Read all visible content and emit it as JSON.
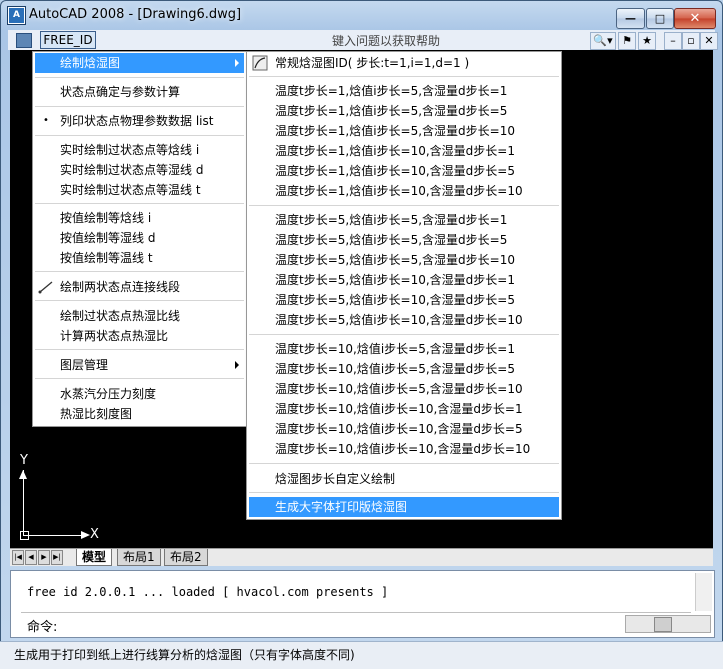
{
  "window": {
    "title": "AutoCAD 2008 - [Drawing6.dwg]",
    "app_icon": "A"
  },
  "caption_buttons": {
    "minimize": "—",
    "maximize": "□",
    "close": "✕"
  },
  "menubar": {
    "menu_label": "FREE_ID",
    "help_placeholder": "键入问题以获取帮助",
    "tools": [
      "🔍▾",
      "⚑",
      "★",
      "–",
      "▫",
      "✕"
    ]
  },
  "main_menu": {
    "items": [
      {
        "label": "绘制焓湿图",
        "submenu": true,
        "highlighted": true
      },
      {
        "label": "状态点确定与参数计算"
      },
      {
        "label": "列印状态点物理参数数据 list",
        "bullet": true
      },
      {
        "label": "实时绘制过状态点等焓线 i"
      },
      {
        "label": "实时绘制过状态点等湿线 d"
      },
      {
        "label": "实时绘制过状态点等温线 t"
      },
      {
        "label": "按值绘制等焓线 i"
      },
      {
        "label": "按值绘制等湿线 d"
      },
      {
        "label": "按值绘制等温线 t"
      },
      {
        "label": "绘制两状态点连接线段",
        "icon": "line-icon"
      },
      {
        "label": "绘制过状态点热湿比线"
      },
      {
        "label": "计算两状态点热湿比"
      },
      {
        "label": "图层管理",
        "submenu": true
      },
      {
        "label": "水蒸汽分压力刻度"
      },
      {
        "label": "热湿比刻度图"
      }
    ]
  },
  "sub_menu": {
    "header": "常规焓湿图ID( 步长:t=1,i=1,d=1 )",
    "group1": [
      "温度t步长=1,焓值i步长=5,含湿量d步长=1",
      "温度t步长=1,焓值i步长=5,含湿量d步长=5",
      "温度t步长=1,焓值i步长=5,含湿量d步长=10",
      "温度t步长=1,焓值i步长=10,含湿量d步长=1",
      "温度t步长=1,焓值i步长=10,含湿量d步长=5",
      "温度t步长=1,焓值i步长=10,含湿量d步长=10"
    ],
    "group2": [
      "温度t步长=5,焓值i步长=5,含湿量d步长=1",
      "温度t步长=5,焓值i步长=5,含湿量d步长=5",
      "温度t步长=5,焓值i步长=5,含湿量d步长=10",
      "温度t步长=5,焓值i步长=10,含湿量d步长=1",
      "温度t步长=5,焓值i步长=10,含湿量d步长=5",
      "温度t步长=5,焓值i步长=10,含湿量d步长=10"
    ],
    "group3": [
      "温度t步长=10,焓值i步长=5,含湿量d步长=1",
      "温度t步长=10,焓值i步长=5,含湿量d步长=5",
      "温度t步长=10,焓值i步长=5,含湿量d步长=10",
      "温度t步长=10,焓值i步长=10,含湿量d步长=1",
      "温度t步长=10,焓值i步长=10,含湿量d步长=5",
      "温度t步长=10,焓值i步长=10,含湿量d步长=10"
    ],
    "custom": "焓湿图步长自定义绘制",
    "large_print": "生成大字体打印版焓湿图"
  },
  "ucs": {
    "x": "X",
    "y": "Y"
  },
  "tabs": [
    "模型",
    "布局1",
    "布局2"
  ],
  "command": {
    "history": "free id  2.0.0.1 ... loaded [ hvacol.com presents ]",
    "prompt": "命令:"
  },
  "status": {
    "text": "生成用于打印到纸上进行线算分析的焓湿图（只有字体高度不同)"
  },
  "colors": {
    "highlight": "#3399ff",
    "canvas": "#000000"
  }
}
